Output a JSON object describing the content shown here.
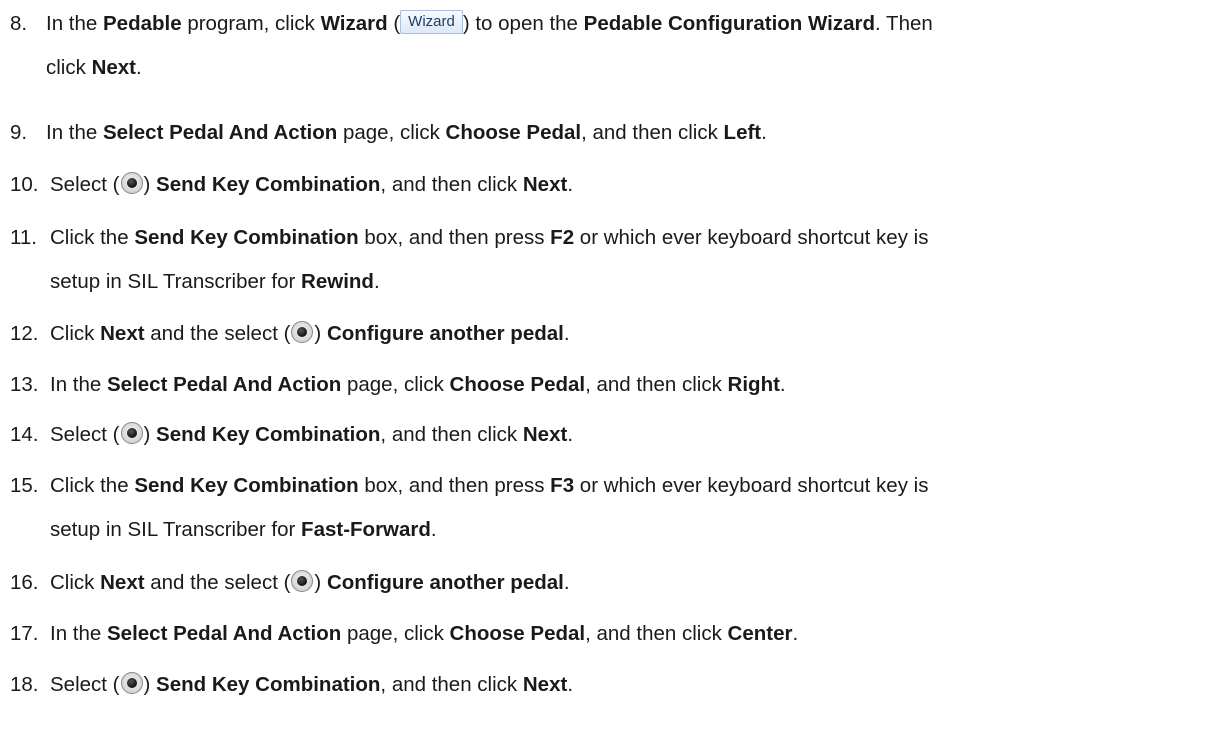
{
  "steps": [
    {
      "num": "8.",
      "line1": [
        "In the ",
        "Pedable",
        " program, click ",
        "Wizard",
        " (",
        "",
        ") to open the ",
        "Pedable Configuration Wizard",
        ". Then"
      ],
      "line2": [
        "click ",
        "Next",
        "."
      ]
    },
    {
      "num": "9.",
      "line1": [
        "In the ",
        "Select Pedal And Action",
        " page, click ",
        "Choose Pedal",
        ", and then click ",
        "Left",
        "."
      ]
    },
    {
      "num": "10.",
      "line1": [
        "Select (",
        "",
        ") ",
        "Send Key Combination",
        ", and then click ",
        "Next",
        "."
      ]
    },
    {
      "num": "11.",
      "line1": [
        "Click the ",
        "Send Key Combination",
        " box, and then press ",
        "F2",
        " or which ever keyboard shortcut key is"
      ],
      "line2": [
        "setup in SIL Transcriber for ",
        "Rewind",
        "."
      ]
    },
    {
      "num": "12.",
      "line1": [
        "Click ",
        "Next",
        " and the select (",
        "",
        ") ",
        "Configure another pedal",
        "."
      ]
    },
    {
      "num": "13.",
      "line1": [
        "In the ",
        "Select Pedal And Action",
        " page, click ",
        "Choose Pedal",
        ", and then click ",
        "Right",
        "."
      ]
    },
    {
      "num": "14.",
      "line1": [
        "Select (",
        "",
        ") ",
        "Send Key Combination",
        ", and then click ",
        "Next",
        "."
      ]
    },
    {
      "num": "15.",
      "line1": [
        "Click the ",
        "Send Key Combination",
        " box, and then press ",
        "F3",
        " or which ever keyboard shortcut key is"
      ],
      "line2": [
        "setup in SIL Transcriber for ",
        "Fast-Forward",
        "."
      ]
    },
    {
      "num": "16.",
      "line1": [
        "Click ",
        "Next",
        " and the select (",
        "",
        ") ",
        "Configure another pedal",
        "."
      ]
    },
    {
      "num": "17.",
      "line1": [
        "In the ",
        "Select Pedal And Action",
        " page, click ",
        "Choose Pedal",
        ", and then click ",
        "Center",
        "."
      ]
    },
    {
      "num": "18.",
      "line1": [
        "Select (",
        "",
        ") ",
        "Send Key Combination",
        ", and then click ",
        "Next",
        "."
      ]
    }
  ],
  "wizard_button_label": "Wizard",
  "icons": {
    "radio": "radio-selected-icon",
    "wizard": "wizard-button-icon"
  }
}
